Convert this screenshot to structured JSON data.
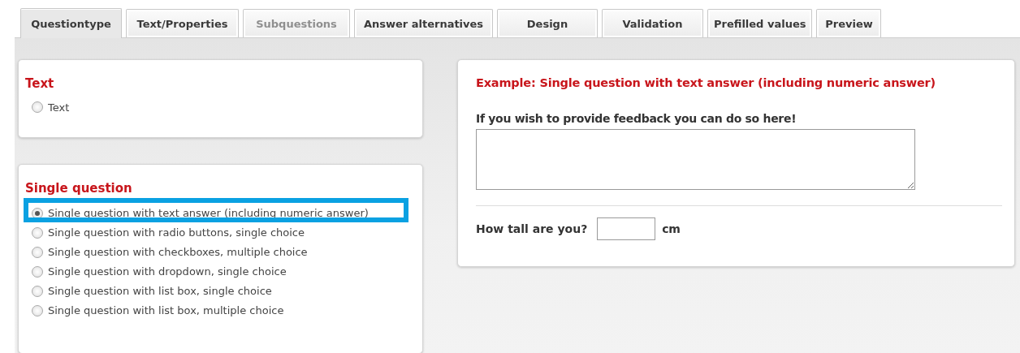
{
  "tabs": [
    {
      "label": "Questiontype",
      "selected": true,
      "disabled": false
    },
    {
      "label": "Text/Properties",
      "selected": false,
      "disabled": false
    },
    {
      "label": "Subquestions",
      "selected": false,
      "disabled": true
    },
    {
      "label": "Answer alternatives",
      "selected": false,
      "disabled": false
    },
    {
      "label": "Design",
      "selected": false,
      "disabled": false
    },
    {
      "label": "Validation",
      "selected": false,
      "disabled": false
    },
    {
      "label": "Prefilled values",
      "selected": false,
      "disabled": false
    },
    {
      "label": "Preview",
      "selected": false,
      "disabled": false
    }
  ],
  "groups": [
    {
      "title": "Text",
      "options": [
        {
          "label": "Text",
          "selected": false,
          "highlighted": false
        }
      ]
    },
    {
      "title": "Single question",
      "options": [
        {
          "label": "Single question with text answer (including numeric answer)",
          "selected": true,
          "highlighted": true
        },
        {
          "label": "Single question with radio buttons, single choice",
          "selected": false,
          "highlighted": false
        },
        {
          "label": "Single question with checkboxes, multiple choice",
          "selected": false,
          "highlighted": false
        },
        {
          "label": "Single question with dropdown, single choice",
          "selected": false,
          "highlighted": false
        },
        {
          "label": "Single question with list box, single choice",
          "selected": false,
          "highlighted": false
        },
        {
          "label": "Single question with list box, multiple choice",
          "selected": false,
          "highlighted": false
        }
      ]
    }
  ],
  "example": {
    "title": "Example: Single question with text answer (including numeric answer)",
    "feedback_label": "If you wish to provide feedback you can do so here!",
    "question": "How tall are you?",
    "unit": "cm"
  }
}
